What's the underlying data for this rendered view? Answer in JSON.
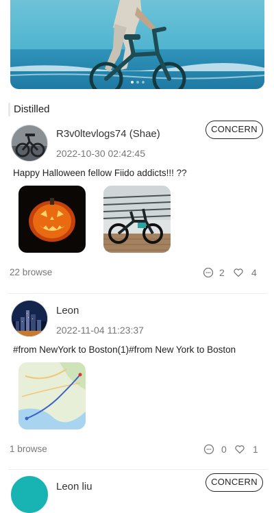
{
  "section": {
    "title": "Distilled"
  },
  "posts": [
    {
      "user": "R3v0ltevlogs74 (Shae)",
      "time": "2022-10-30 02:42:45",
      "follow_label": "CONCERN",
      "text": "Happy Halloween fellow Fiido addicts!!! ??",
      "browse": "22 browse",
      "comments": "2",
      "likes": "4"
    },
    {
      "user": "Leon",
      "time": "2022-11-04 11:23:37",
      "text": "#from NewYork to Boston(1)#from New York to Boston",
      "browse": "1 browse",
      "comments": "0",
      "likes": "1"
    },
    {
      "user": "Leon liu",
      "follow_label": "CONCERN"
    }
  ],
  "icons": {
    "comment": "comment-icon",
    "like": "heart-icon"
  },
  "colors": {
    "sea": "#3fa8c8",
    "divider": "#eeeeee",
    "avatar_teal": "#18b3b3"
  }
}
